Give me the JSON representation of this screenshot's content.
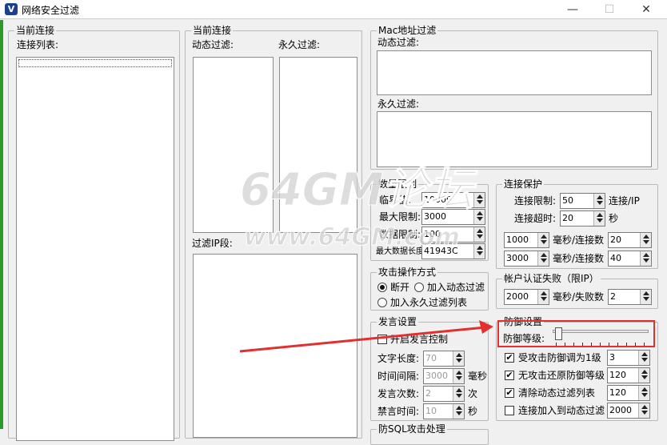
{
  "window": {
    "title": "网络安全过滤",
    "minimize": "—",
    "maximize": "☐",
    "close": "✕"
  },
  "current_connections": {
    "group": "当前连接",
    "list_label": "连接列表:"
  },
  "filters": {
    "group": "当前连接",
    "dynamic_label": "动态过滤:",
    "permanent_label": "永久过滤:",
    "ip_segment_label": "过滤IP段:"
  },
  "mac_filter": {
    "group": "Mac地址过滤",
    "dynamic_label": "动态过滤:",
    "permanent_label": "永久过滤:"
  },
  "quantity_limit": {
    "group": "数量限制",
    "rows": [
      {
        "label": "临界值:",
        "value": "10000"
      },
      {
        "label": "最大限制:",
        "value": "3000"
      },
      {
        "label": "数据限制:",
        "value": "100"
      },
      {
        "label": "最大数据长度:",
        "value": "41943C"
      }
    ]
  },
  "connection_protection": {
    "group": "连接保护",
    "limit_label": "连接限制:",
    "limit_value": "50",
    "limit_unit": "连接/IP",
    "timeout_label": "连接超时:",
    "timeout_value": "20",
    "timeout_unit": "秒",
    "rate_rows": [
      {
        "ms": "1000",
        "unit": "毫秒/连接数",
        "count": "20"
      },
      {
        "ms": "3000",
        "unit": "毫秒/连接数",
        "count": "40"
      }
    ]
  },
  "attack_mode": {
    "group": "攻击操作方式",
    "options": [
      "断开",
      "加入动态过滤",
      "加入永久过滤列表"
    ],
    "selected": "断开"
  },
  "auth_failure": {
    "group": "帐户认证失败（限IP）",
    "ms": "2000",
    "unit": "毫秒/失败数",
    "count": "2"
  },
  "speech": {
    "group": "发言设置",
    "enable_label": "开启发言控制",
    "enabled": false,
    "rows": [
      {
        "label": "文字长度:",
        "value": "70",
        "unit": ""
      },
      {
        "label": "时间间隔:",
        "value": "3000",
        "unit": "毫秒"
      },
      {
        "label": "发言次数:",
        "value": "2",
        "unit": "次"
      },
      {
        "label": "禁言时间:",
        "value": "10",
        "unit": "秒"
      }
    ],
    "next_group": "防SQL攻击处理"
  },
  "defense": {
    "group": "防御设置",
    "level_label": "防御等级:",
    "level_fraction": 0.03,
    "options": [
      {
        "label": "受攻击防御调为1级",
        "value": "3",
        "checked": true
      },
      {
        "label": "无攻击还原防御等级",
        "value": "120",
        "checked": true
      },
      {
        "label": "清除动态过滤列表",
        "value": "120",
        "checked": true
      },
      {
        "label": "连接加入到动态过滤",
        "value": "2000",
        "checked": false
      }
    ]
  },
  "watermark": {
    "line1": "64GM论坛",
    "line2": "www.64GM.com"
  },
  "colors": {
    "annotation_red": "#e03030",
    "watermark": "#dcdcdc"
  }
}
